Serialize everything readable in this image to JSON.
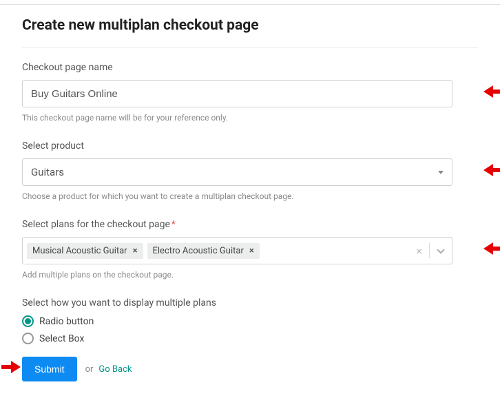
{
  "page_title": "Create new multiplan checkout page",
  "checkout_name": {
    "label": "Checkout page name",
    "value": "Buy Guitars Online",
    "helper": "This checkout page name will be for your reference only."
  },
  "product": {
    "label": "Select product",
    "selected": "Guitars",
    "helper": "Choose a product for which you want to create a multiplan checkout page."
  },
  "plans": {
    "label": "Select plans for the checkout page",
    "tags": [
      "Musical Acoustic Guitar",
      "Electro Acoustic Guitar"
    ],
    "helper": "Add multiple plans on the checkout page."
  },
  "display": {
    "label": "Select how you want to display multiple plans",
    "options": [
      "Radio button",
      "Select Box"
    ],
    "selected_index": 0
  },
  "actions": {
    "submit": "Submit",
    "or": "or",
    "go_back": "Go Back"
  }
}
